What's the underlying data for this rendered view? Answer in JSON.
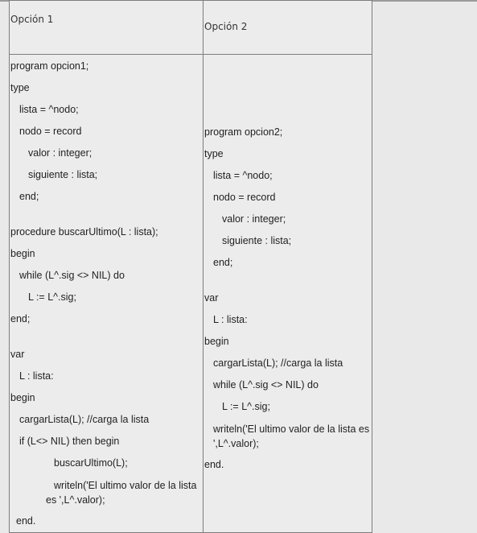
{
  "header": {
    "option1": "Opción 1",
    "option2": "Opción 2"
  },
  "option1_code": {
    "l01": "program opcion1;",
    "l02": "type",
    "l03": "lista = ^nodo;",
    "l04": "nodo = record",
    "l05": "valor : integer;",
    "l06": "siguiente : lista;",
    "l07": "end;",
    "l08": "procedure buscarUltimo(L : lista);",
    "l09": "begin",
    "l10": "while (L^.sig <> NIL) do",
    "l11": "L := L^.sig;",
    "l12": "end;",
    "l13": "var",
    "l14": "L : lista:",
    "l15": "begin",
    "l16": "cargarLista(L); //carga la lista",
    "l17": "if (L<> NIL) then begin",
    "l18": "buscarUltimo(L);",
    "l19": "writeln('El ultimo valor de la lista es ',L^.valor);",
    "l20": "end."
  },
  "option2_code": {
    "l01": "program opcion2;",
    "l02": "type",
    "l03": "lista = ^nodo;",
    "l04": "nodo = record",
    "l05": "valor : integer;",
    "l06": "siguiente : lista;",
    "l07": "end;",
    "l08": "var",
    "l09": "L : lista:",
    "l10": "begin",
    "l11": "cargarLista(L); //carga la lista",
    "l12": "while (L^.sig <> NIL) do",
    "l13": "L := L^.sig;",
    "l14": "writeln('El ultimo valor de la lista es ',L^.valor);",
    "l15": "end."
  }
}
